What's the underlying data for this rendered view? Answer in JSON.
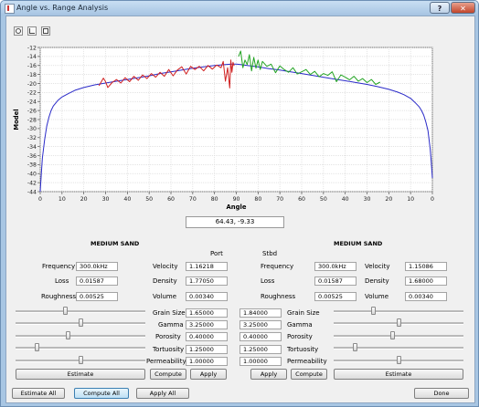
{
  "window": {
    "title": "Angle vs. Range Analysis",
    "help_label": "?",
    "close_label": "✕"
  },
  "toolbar": {
    "icons": [
      "zoom-icon",
      "chart-icon",
      "copy-icon"
    ]
  },
  "chart_data": {
    "type": "line",
    "ylabel": "Model",
    "xlabel": "Angle",
    "ylim": [
      -44,
      -12
    ],
    "yticks": [
      "-12",
      "-14",
      "-16",
      "-18",
      "-20",
      "-22",
      "-24",
      "-26",
      "-28",
      "-30",
      "-32",
      "-34",
      "-36",
      "-38",
      "-40",
      "-42",
      "-44"
    ],
    "xticks": [
      "0",
      "10",
      "20",
      "30",
      "40",
      "50",
      "60",
      "70",
      "80",
      "90",
      "80",
      "70",
      "60",
      "50",
      "40",
      "30",
      "20",
      "10",
      "0"
    ],
    "grid": true,
    "series": [
      {
        "color": "#2a2ac8",
        "x": [
          0,
          0.5,
          1,
          2,
          3,
          4,
          5,
          6,
          8,
          10,
          13,
          16,
          20,
          25,
          30,
          35,
          40,
          45,
          50,
          55,
          60,
          65,
          70,
          75,
          80,
          85,
          88,
          90,
          92,
          95,
          100,
          105,
          110,
          115,
          120,
          125,
          130,
          135,
          140,
          145,
          150,
          155,
          160,
          164,
          167,
          170,
          172,
          174,
          175,
          176,
          177,
          178,
          179,
          179.5,
          180
        ],
        "y": [
          -44,
          -40,
          -36.5,
          -32.5,
          -29.5,
          -27.5,
          -26,
          -25,
          -23.8,
          -23,
          -22.2,
          -21.5,
          -20.9,
          -20.3,
          -19.9,
          -19.5,
          -19.1,
          -18.7,
          -18.3,
          -17.8,
          -17.4,
          -17,
          -16.6,
          -16.3,
          -16,
          -15.8,
          -15.7,
          -15.7,
          -15.8,
          -16,
          -16.3,
          -16.7,
          -17,
          -17.4,
          -17.8,
          -18.2,
          -18.6,
          -19,
          -19.4,
          -19.8,
          -20.2,
          -20.7,
          -21.3,
          -21.9,
          -22.5,
          -23.3,
          -24.2,
          -25.2,
          -26,
          -27,
          -28.5,
          -30.5,
          -34.5,
          -37.5,
          -41
        ]
      },
      {
        "color": "#d02020",
        "x": [
          27,
          29,
          30,
          31,
          33,
          35,
          37,
          39,
          41,
          43,
          45,
          47,
          49,
          51,
          53,
          55,
          57,
          59,
          61,
          63,
          65,
          67,
          69,
          71,
          73,
          75,
          77,
          79,
          81,
          83,
          84,
          85,
          86,
          87,
          87.5,
          88,
          88.5,
          89
        ],
        "y": [
          -20.5,
          -18.8,
          -19.6,
          -20.9,
          -19.8,
          -19.1,
          -19.9,
          -18.7,
          -19.6,
          -18.4,
          -19.3,
          -18.1,
          -18.9,
          -17.8,
          -18.6,
          -17.5,
          -18.4,
          -16.9,
          -18.3,
          -17,
          -16.3,
          -17.9,
          -16.2,
          -16.9,
          -16.2,
          -17.2,
          -16,
          -16.8,
          -15.9,
          -16.5,
          -15.1,
          -19.5,
          -16.5,
          -21,
          -14.8,
          -17.5,
          -15.3,
          -16.1
        ]
      },
      {
        "color": "#22a322",
        "x": [
          91,
          92,
          93,
          94,
          95,
          96,
          97,
          98,
          99,
          100,
          101,
          102,
          104,
          106,
          108,
          110,
          112,
          114,
          116,
          118,
          120,
          122,
          124,
          126,
          128,
          130,
          132,
          134,
          136,
          138,
          140,
          142,
          144,
          146,
          148,
          150,
          152,
          154,
          156
        ],
        "y": [
          -14,
          -12.8,
          -16.5,
          -14.8,
          -15.8,
          -13.6,
          -17.2,
          -14.2,
          -16.6,
          -14.8,
          -16.9,
          -15.1,
          -16.2,
          -15.7,
          -17.6,
          -16.1,
          -16.9,
          -17.5,
          -16.5,
          -17.9,
          -17.4,
          -16.9,
          -18,
          -17.3,
          -18.5,
          -17.8,
          -18.2,
          -17.4,
          -19.6,
          -18.1,
          -18.6,
          -19.2,
          -18.4,
          -19.5,
          -18.9,
          -19.8,
          -19.1,
          -20.2,
          -19.7
        ]
      }
    ]
  },
  "readout": "64.43, -9.33",
  "left": {
    "header": "MEDIUM SAND",
    "freq_label": "Frequency",
    "freq_value": "300.0kHz",
    "loss_label": "Loss",
    "loss_value": "0.01587",
    "rough_label": "Roughness",
    "rough_value": "0.00525",
    "vel_label": "Velocity",
    "vel_value": "1.16218",
    "dens_label": "Density",
    "dens_value": "1.77050",
    "vol_label": "Volume",
    "vol_value": "0.00340",
    "sliders": [
      0.38,
      0.5,
      0.4,
      0.15,
      0.5
    ],
    "estimate_label": "Estimate"
  },
  "right": {
    "header": "MEDIUM SAND",
    "freq_label": "Frequency",
    "freq_value": "300.0kHz",
    "loss_label": "Loss",
    "loss_value": "0.01587",
    "rough_label": "Roughness",
    "rough_value": "0.00525",
    "vel_label": "Velocity",
    "vel_value": "1.15086",
    "dens_label": "Density",
    "dens_value": "1.68000",
    "vol_label": "Volume",
    "vol_value": "0.00340",
    "sliders": [
      0.3,
      0.5,
      0.45,
      0.15,
      0.5
    ],
    "estimate_label": "Estimate"
  },
  "port": {
    "label": "Port",
    "grain_label": "Grain Size",
    "grain_value": "1.65000",
    "gamma_label": "Gamma",
    "gamma_value": "3.25000",
    "poro_label": "Porosity",
    "poro_value": "0.40000",
    "tort_label": "Tortuosity",
    "tort_value": "1.25000",
    "perm_label": "Permeability",
    "perm_value": "1.00000",
    "compute_label": "Compute",
    "apply_label": "Apply"
  },
  "stbd": {
    "label": "Stbd",
    "grain_label": "Grain Size",
    "grain_value": "1.84000",
    "gamma_label": "Gamma",
    "gamma_value": "3.25000",
    "poro_label": "Porosity",
    "poro_value": "0.40000",
    "tort_label": "Tortuosity",
    "tort_value": "1.25000",
    "perm_label": "Permeability",
    "perm_value": "1.00000",
    "apply_label": "Apply",
    "compute_label": "Compute"
  },
  "footer": {
    "estimate_all": "Estimate All",
    "compute_all": "Compute All",
    "apply_all": "Apply All",
    "done": "Done"
  }
}
